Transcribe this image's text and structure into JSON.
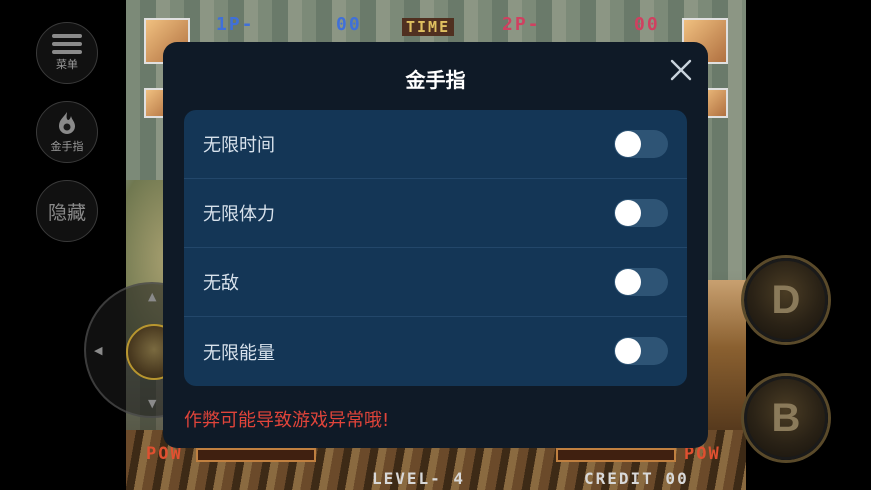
{
  "side_buttons": {
    "menu_label": "菜单",
    "cheat_label": "金手指",
    "hide_label": "隐藏"
  },
  "game": {
    "p1_label": "1P-",
    "p1_score": "00",
    "time_label": "TIME",
    "p2_label": "2P-",
    "p2_score": "00",
    "pow_label": "POW",
    "level_label": "LEVEL- 4",
    "credit_label": "CREDIT 00"
  },
  "action_buttons": {
    "d_label": "D",
    "b_label": "B"
  },
  "dialog": {
    "title": "金手指",
    "close_icon": "close-icon",
    "cheats": [
      {
        "label": "无限时间",
        "enabled": false
      },
      {
        "label": "无限体力",
        "enabled": false
      },
      {
        "label": "无敌",
        "enabled": false
      },
      {
        "label": "无限能量",
        "enabled": false
      }
    ],
    "warning": "作弊可能导致游戏异常哦!"
  },
  "colors": {
    "dialog_bg": "#0f1a27",
    "list_bg": "#143656",
    "toggle_off": "#2e5475",
    "warning": "#e0443a"
  }
}
